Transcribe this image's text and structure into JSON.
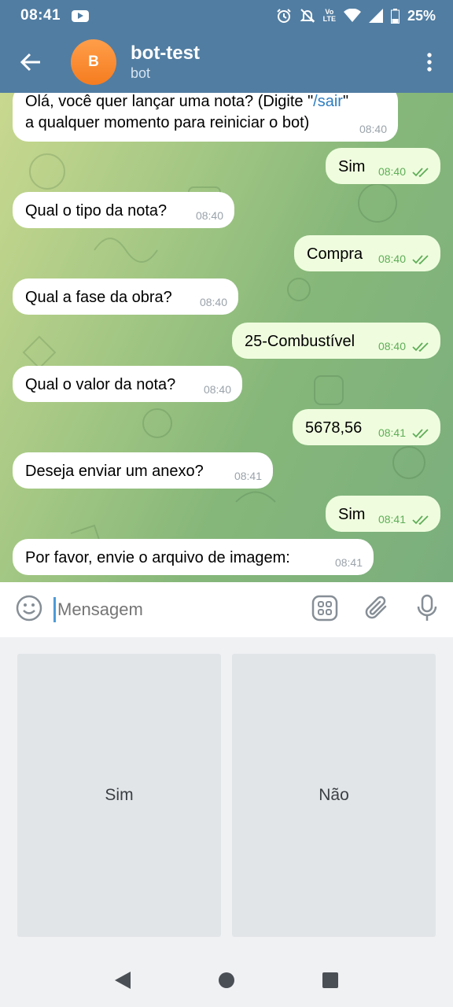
{
  "status_bar": {
    "time": "08:41",
    "battery": "25%",
    "network_label_top": "Vo",
    "network_label_bottom": "LTE"
  },
  "header": {
    "avatar_letter": "B",
    "title": "bot-test",
    "subtitle": "bot"
  },
  "messages": [
    {
      "dir": "in",
      "line1_a": "Olá, você quer lançar uma nota? (Digite \"",
      "line1_link": "/sair",
      "line1_b": "\"",
      "line2": "a qualquer momento para reiniciar o bot)",
      "time": "08:40"
    },
    {
      "dir": "out",
      "text": "Sim",
      "time": "08:40"
    },
    {
      "dir": "in",
      "text": "Qual o tipo da nota?",
      "time": "08:40"
    },
    {
      "dir": "out",
      "text": "Compra",
      "time": "08:40"
    },
    {
      "dir": "in",
      "text": "Qual a fase da obra?",
      "time": "08:40"
    },
    {
      "dir": "out",
      "text": "25-Combustível",
      "time": "08:40"
    },
    {
      "dir": "in",
      "text": "Qual o valor da nota?",
      "time": "08:40"
    },
    {
      "dir": "out",
      "text": "5678,56",
      "time": "08:41"
    },
    {
      "dir": "in",
      "text": "Deseja enviar um anexo?",
      "time": "08:41"
    },
    {
      "dir": "out",
      "text": "Sim",
      "time": "08:41"
    },
    {
      "dir": "in",
      "text": "Por favor, envie o arquivo de imagem:",
      "time": "08:41"
    }
  ],
  "input": {
    "placeholder": "Mensagem"
  },
  "keyboard": {
    "buttons": [
      "Sim",
      "Não"
    ]
  },
  "colors": {
    "header": "#517da2",
    "outgoing_bubble": "#effdde",
    "incoming_bubble": "#ffffff",
    "avatar": "#f57c1f"
  }
}
